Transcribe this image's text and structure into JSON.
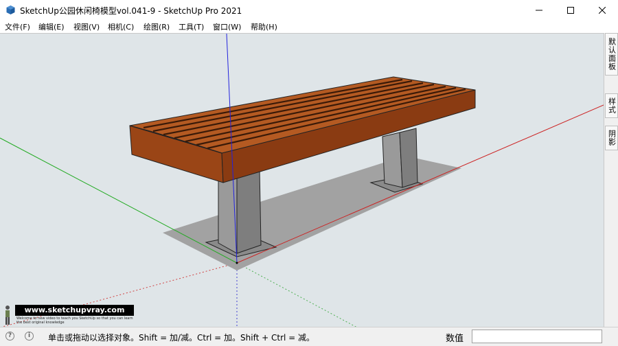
{
  "window": {
    "title": "SketchUp公园休闲椅模型vol.041-9 - SketchUp Pro 2021"
  },
  "menu": [
    {
      "label": "文件(F)"
    },
    {
      "label": "编辑(E)"
    },
    {
      "label": "视图(V)"
    },
    {
      "label": "相机(C)"
    },
    {
      "label": "绘图(R)"
    },
    {
      "label": "工具(T)"
    },
    {
      "label": "窗口(W)"
    },
    {
      "label": "帮助(H)"
    }
  ],
  "side_tabs": [
    {
      "label": "默认面板"
    },
    {
      "label": "样式"
    },
    {
      "label": "阴影"
    }
  ],
  "status": {
    "hint": "单击或拖动以选择对象。Shift = 加/减。Ctrl = 加。Shift + Ctrl = 减。",
    "measurements_label": "数值",
    "measurements_value": ""
  },
  "watermark": {
    "url": "www.sketchupvray.com",
    "tagline": "Welcome to new video to teach you SketchUp so that you can learn the best original knowledge"
  },
  "colors": {
    "viewport_bg": "#dfe5e8",
    "wood": "#b85a1e",
    "wood_dark": "#7a3410",
    "leg": "#8c8c8c",
    "shadow": "#9e9e9e",
    "axis_red": "#cc2222",
    "axis_green": "#22aa22",
    "axis_blue": "#2222cc"
  },
  "icons": {
    "app": "sketchup-app-icon",
    "minimize": "minimize-icon",
    "maximize": "maximize-icon",
    "close": "close-icon",
    "geo": "geolocation-icon",
    "info": "info-icon"
  }
}
